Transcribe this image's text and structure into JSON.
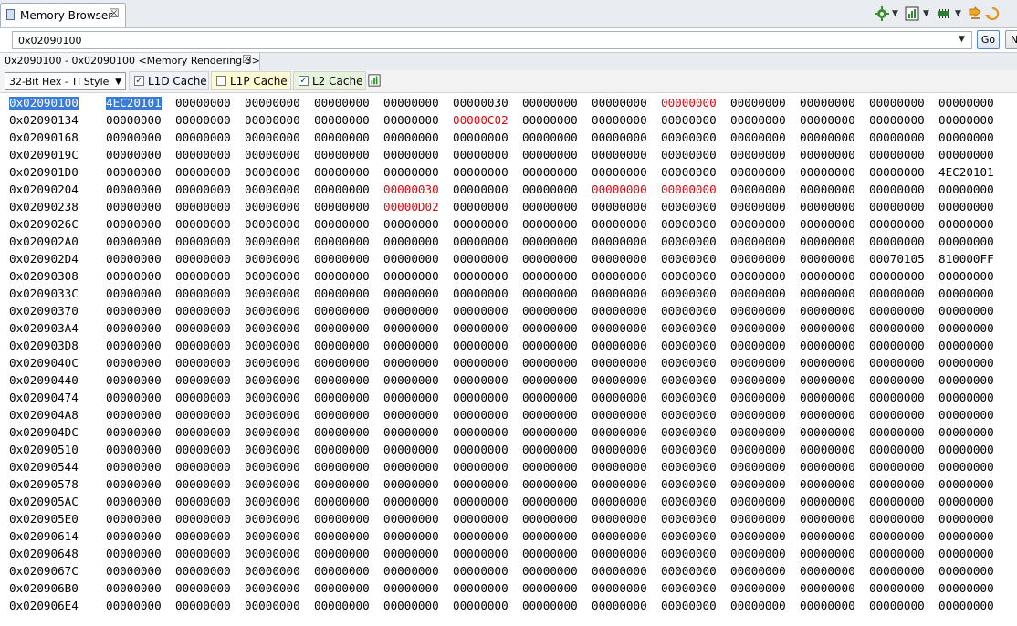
{
  "view_tab": {
    "title": "Memory Browser",
    "close": "☒"
  },
  "address_bar": {
    "value": "0x02090100",
    "go_label": "Go",
    "n_label": "N"
  },
  "rendering_tab": {
    "label": "0x2090100 - 0x02090100 <Memory Rendering 3>",
    "close": "☒"
  },
  "format": {
    "selected": "32-Bit Hex - TI Style"
  },
  "cache_options": [
    {
      "label": "L1D Cache",
      "checked": true
    },
    {
      "label": "L1P Cache",
      "checked": false
    },
    {
      "label": "L2 Cache",
      "checked": true
    }
  ],
  "colors": {
    "changed": "#e8000b",
    "selection": "#3a7bd5"
  },
  "memory": {
    "rows": [
      {
        "addr": "0x02090100",
        "cells": [
          "4EC20101",
          "00000000",
          "00000000",
          "00000000",
          "00000000",
          "00000030",
          "00000000",
          "00000000",
          "00000000",
          "00000000",
          "00000000",
          "00000000",
          "00000000"
        ]
      },
      {
        "addr": "0x02090134",
        "cells": [
          "00000000",
          "00000000",
          "00000000",
          "00000000",
          "00000000",
          "00000C02",
          "00000000",
          "00000000",
          "00000000",
          "00000000",
          "00000000",
          "00000000",
          "00000000"
        ]
      },
      {
        "addr": "0x02090168",
        "cells": [
          "00000000",
          "00000000",
          "00000000",
          "00000000",
          "00000000",
          "00000000",
          "00000000",
          "00000000",
          "00000000",
          "00000000",
          "00000000",
          "00000000",
          "00000000"
        ]
      },
      {
        "addr": "0x0209019C",
        "cells": [
          "00000000",
          "00000000",
          "00000000",
          "00000000",
          "00000000",
          "00000000",
          "00000000",
          "00000000",
          "00000000",
          "00000000",
          "00000000",
          "00000000",
          "00000000"
        ]
      },
      {
        "addr": "0x020901D0",
        "cells": [
          "00000000",
          "00000000",
          "00000000",
          "00000000",
          "00000000",
          "00000000",
          "00000000",
          "00000000",
          "00000000",
          "00000000",
          "00000000",
          "00000000",
          "4EC20101"
        ]
      },
      {
        "addr": "0x02090204",
        "cells": [
          "00000000",
          "00000000",
          "00000000",
          "00000000",
          "00000030",
          "00000000",
          "00000000",
          "00000000",
          "00000000",
          "00000000",
          "00000000",
          "00000000",
          "00000000"
        ]
      },
      {
        "addr": "0x02090238",
        "cells": [
          "00000000",
          "00000000",
          "00000000",
          "00000000",
          "00000D02",
          "00000000",
          "00000000",
          "00000000",
          "00000000",
          "00000000",
          "00000000",
          "00000000",
          "00000000"
        ]
      },
      {
        "addr": "0x0209026C",
        "cells": [
          "00000000",
          "00000000",
          "00000000",
          "00000000",
          "00000000",
          "00000000",
          "00000000",
          "00000000",
          "00000000",
          "00000000",
          "00000000",
          "00000000",
          "00000000"
        ]
      },
      {
        "addr": "0x020902A0",
        "cells": [
          "00000000",
          "00000000",
          "00000000",
          "00000000",
          "00000000",
          "00000000",
          "00000000",
          "00000000",
          "00000000",
          "00000000",
          "00000000",
          "00000000",
          "00000000"
        ]
      },
      {
        "addr": "0x020902D4",
        "cells": [
          "00000000",
          "00000000",
          "00000000",
          "00000000",
          "00000000",
          "00000000",
          "00000000",
          "00000000",
          "00000000",
          "00000000",
          "00000000",
          "00070105",
          "810000FF"
        ]
      },
      {
        "addr": "0x02090308",
        "cells": [
          "00000000",
          "00000000",
          "00000000",
          "00000000",
          "00000000",
          "00000000",
          "00000000",
          "00000000",
          "00000000",
          "00000000",
          "00000000",
          "00000000",
          "00000000"
        ]
      },
      {
        "addr": "0x0209033C",
        "cells": [
          "00000000",
          "00000000",
          "00000000",
          "00000000",
          "00000000",
          "00000000",
          "00000000",
          "00000000",
          "00000000",
          "00000000",
          "00000000",
          "00000000",
          "00000000"
        ]
      },
      {
        "addr": "0x02090370",
        "cells": [
          "00000000",
          "00000000",
          "00000000",
          "00000000",
          "00000000",
          "00000000",
          "00000000",
          "00000000",
          "00000000",
          "00000000",
          "00000000",
          "00000000",
          "00000000"
        ]
      },
      {
        "addr": "0x020903A4",
        "cells": [
          "00000000",
          "00000000",
          "00000000",
          "00000000",
          "00000000",
          "00000000",
          "00000000",
          "00000000",
          "00000000",
          "00000000",
          "00000000",
          "00000000",
          "00000000"
        ]
      },
      {
        "addr": "0x020903D8",
        "cells": [
          "00000000",
          "00000000",
          "00000000",
          "00000000",
          "00000000",
          "00000000",
          "00000000",
          "00000000",
          "00000000",
          "00000000",
          "00000000",
          "00000000",
          "00000000"
        ]
      },
      {
        "addr": "0x0209040C",
        "cells": [
          "00000000",
          "00000000",
          "00000000",
          "00000000",
          "00000000",
          "00000000",
          "00000000",
          "00000000",
          "00000000",
          "00000000",
          "00000000",
          "00000000",
          "00000000"
        ]
      },
      {
        "addr": "0x02090440",
        "cells": [
          "00000000",
          "00000000",
          "00000000",
          "00000000",
          "00000000",
          "00000000",
          "00000000",
          "00000000",
          "00000000",
          "00000000",
          "00000000",
          "00000000",
          "00000000"
        ]
      },
      {
        "addr": "0x02090474",
        "cells": [
          "00000000",
          "00000000",
          "00000000",
          "00000000",
          "00000000",
          "00000000",
          "00000000",
          "00000000",
          "00000000",
          "00000000",
          "00000000",
          "00000000",
          "00000000"
        ]
      },
      {
        "addr": "0x020904A8",
        "cells": [
          "00000000",
          "00000000",
          "00000000",
          "00000000",
          "00000000",
          "00000000",
          "00000000",
          "00000000",
          "00000000",
          "00000000",
          "00000000",
          "00000000",
          "00000000"
        ]
      },
      {
        "addr": "0x020904DC",
        "cells": [
          "00000000",
          "00000000",
          "00000000",
          "00000000",
          "00000000",
          "00000000",
          "00000000",
          "00000000",
          "00000000",
          "00000000",
          "00000000",
          "00000000",
          "00000000"
        ]
      },
      {
        "addr": "0x02090510",
        "cells": [
          "00000000",
          "00000000",
          "00000000",
          "00000000",
          "00000000",
          "00000000",
          "00000000",
          "00000000",
          "00000000",
          "00000000",
          "00000000",
          "00000000",
          "00000000"
        ]
      },
      {
        "addr": "0x02090544",
        "cells": [
          "00000000",
          "00000000",
          "00000000",
          "00000000",
          "00000000",
          "00000000",
          "00000000",
          "00000000",
          "00000000",
          "00000000",
          "00000000",
          "00000000",
          "00000000"
        ]
      },
      {
        "addr": "0x02090578",
        "cells": [
          "00000000",
          "00000000",
          "00000000",
          "00000000",
          "00000000",
          "00000000",
          "00000000",
          "00000000",
          "00000000",
          "00000000",
          "00000000",
          "00000000",
          "00000000"
        ]
      },
      {
        "addr": "0x020905AC",
        "cells": [
          "00000000",
          "00000000",
          "00000000",
          "00000000",
          "00000000",
          "00000000",
          "00000000",
          "00000000",
          "00000000",
          "00000000",
          "00000000",
          "00000000",
          "00000000"
        ]
      },
      {
        "addr": "0x020905E0",
        "cells": [
          "00000000",
          "00000000",
          "00000000",
          "00000000",
          "00000000",
          "00000000",
          "00000000",
          "00000000",
          "00000000",
          "00000000",
          "00000000",
          "00000000",
          "00000000"
        ]
      },
      {
        "addr": "0x02090614",
        "cells": [
          "00000000",
          "00000000",
          "00000000",
          "00000000",
          "00000000",
          "00000000",
          "00000000",
          "00000000",
          "00000000",
          "00000000",
          "00000000",
          "00000000",
          "00000000"
        ]
      },
      {
        "addr": "0x02090648",
        "cells": [
          "00000000",
          "00000000",
          "00000000",
          "00000000",
          "00000000",
          "00000000",
          "00000000",
          "00000000",
          "00000000",
          "00000000",
          "00000000",
          "00000000",
          "00000000"
        ]
      },
      {
        "addr": "0x0209067C",
        "cells": [
          "00000000",
          "00000000",
          "00000000",
          "00000000",
          "00000000",
          "00000000",
          "00000000",
          "00000000",
          "00000000",
          "00000000",
          "00000000",
          "00000000",
          "00000000"
        ]
      },
      {
        "addr": "0x020906B0",
        "cells": [
          "00000000",
          "00000000",
          "00000000",
          "00000000",
          "00000000",
          "00000000",
          "00000000",
          "00000000",
          "00000000",
          "00000000",
          "00000000",
          "00000000",
          "00000000"
        ]
      },
      {
        "addr": "0x020906E4",
        "cells": [
          "00000000",
          "00000000",
          "00000000",
          "00000000",
          "00000000",
          "00000000",
          "00000000",
          "00000000",
          "00000000",
          "00000000",
          "00000000",
          "00000000",
          "00000000"
        ]
      }
    ],
    "changed_cells": [
      [
        0,
        8
      ],
      [
        1,
        5
      ],
      [
        5,
        4
      ],
      [
        5,
        7
      ],
      [
        5,
        8
      ],
      [
        6,
        4
      ]
    ],
    "selected_cells": [
      [
        0,
        0
      ]
    ],
    "selected_address_row": 0
  }
}
